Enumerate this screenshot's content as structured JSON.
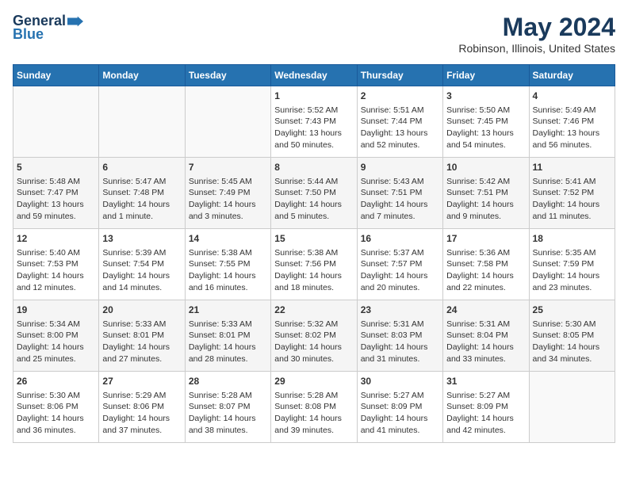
{
  "logo": {
    "line1": "General",
    "line2": "Blue"
  },
  "title": "May 2024",
  "subtitle": "Robinson, Illinois, United States",
  "days_of_week": [
    "Sunday",
    "Monday",
    "Tuesday",
    "Wednesday",
    "Thursday",
    "Friday",
    "Saturday"
  ],
  "weeks": [
    [
      {
        "day": "",
        "content": ""
      },
      {
        "day": "",
        "content": ""
      },
      {
        "day": "",
        "content": ""
      },
      {
        "day": "1",
        "content": "Sunrise: 5:52 AM\nSunset: 7:43 PM\nDaylight: 13 hours\nand 50 minutes."
      },
      {
        "day": "2",
        "content": "Sunrise: 5:51 AM\nSunset: 7:44 PM\nDaylight: 13 hours\nand 52 minutes."
      },
      {
        "day": "3",
        "content": "Sunrise: 5:50 AM\nSunset: 7:45 PM\nDaylight: 13 hours\nand 54 minutes."
      },
      {
        "day": "4",
        "content": "Sunrise: 5:49 AM\nSunset: 7:46 PM\nDaylight: 13 hours\nand 56 minutes."
      }
    ],
    [
      {
        "day": "5",
        "content": "Sunrise: 5:48 AM\nSunset: 7:47 PM\nDaylight: 13 hours\nand 59 minutes."
      },
      {
        "day": "6",
        "content": "Sunrise: 5:47 AM\nSunset: 7:48 PM\nDaylight: 14 hours\nand 1 minute."
      },
      {
        "day": "7",
        "content": "Sunrise: 5:45 AM\nSunset: 7:49 PM\nDaylight: 14 hours\nand 3 minutes."
      },
      {
        "day": "8",
        "content": "Sunrise: 5:44 AM\nSunset: 7:50 PM\nDaylight: 14 hours\nand 5 minutes."
      },
      {
        "day": "9",
        "content": "Sunrise: 5:43 AM\nSunset: 7:51 PM\nDaylight: 14 hours\nand 7 minutes."
      },
      {
        "day": "10",
        "content": "Sunrise: 5:42 AM\nSunset: 7:51 PM\nDaylight: 14 hours\nand 9 minutes."
      },
      {
        "day": "11",
        "content": "Sunrise: 5:41 AM\nSunset: 7:52 PM\nDaylight: 14 hours\nand 11 minutes."
      }
    ],
    [
      {
        "day": "12",
        "content": "Sunrise: 5:40 AM\nSunset: 7:53 PM\nDaylight: 14 hours\nand 12 minutes."
      },
      {
        "day": "13",
        "content": "Sunrise: 5:39 AM\nSunset: 7:54 PM\nDaylight: 14 hours\nand 14 minutes."
      },
      {
        "day": "14",
        "content": "Sunrise: 5:38 AM\nSunset: 7:55 PM\nDaylight: 14 hours\nand 16 minutes."
      },
      {
        "day": "15",
        "content": "Sunrise: 5:38 AM\nSunset: 7:56 PM\nDaylight: 14 hours\nand 18 minutes."
      },
      {
        "day": "16",
        "content": "Sunrise: 5:37 AM\nSunset: 7:57 PM\nDaylight: 14 hours\nand 20 minutes."
      },
      {
        "day": "17",
        "content": "Sunrise: 5:36 AM\nSunset: 7:58 PM\nDaylight: 14 hours\nand 22 minutes."
      },
      {
        "day": "18",
        "content": "Sunrise: 5:35 AM\nSunset: 7:59 PM\nDaylight: 14 hours\nand 23 minutes."
      }
    ],
    [
      {
        "day": "19",
        "content": "Sunrise: 5:34 AM\nSunset: 8:00 PM\nDaylight: 14 hours\nand 25 minutes."
      },
      {
        "day": "20",
        "content": "Sunrise: 5:33 AM\nSunset: 8:01 PM\nDaylight: 14 hours\nand 27 minutes."
      },
      {
        "day": "21",
        "content": "Sunrise: 5:33 AM\nSunset: 8:01 PM\nDaylight: 14 hours\nand 28 minutes."
      },
      {
        "day": "22",
        "content": "Sunrise: 5:32 AM\nSunset: 8:02 PM\nDaylight: 14 hours\nand 30 minutes."
      },
      {
        "day": "23",
        "content": "Sunrise: 5:31 AM\nSunset: 8:03 PM\nDaylight: 14 hours\nand 31 minutes."
      },
      {
        "day": "24",
        "content": "Sunrise: 5:31 AM\nSunset: 8:04 PM\nDaylight: 14 hours\nand 33 minutes."
      },
      {
        "day": "25",
        "content": "Sunrise: 5:30 AM\nSunset: 8:05 PM\nDaylight: 14 hours\nand 34 minutes."
      }
    ],
    [
      {
        "day": "26",
        "content": "Sunrise: 5:30 AM\nSunset: 8:06 PM\nDaylight: 14 hours\nand 36 minutes."
      },
      {
        "day": "27",
        "content": "Sunrise: 5:29 AM\nSunset: 8:06 PM\nDaylight: 14 hours\nand 37 minutes."
      },
      {
        "day": "28",
        "content": "Sunrise: 5:28 AM\nSunset: 8:07 PM\nDaylight: 14 hours\nand 38 minutes."
      },
      {
        "day": "29",
        "content": "Sunrise: 5:28 AM\nSunset: 8:08 PM\nDaylight: 14 hours\nand 39 minutes."
      },
      {
        "day": "30",
        "content": "Sunrise: 5:27 AM\nSunset: 8:09 PM\nDaylight: 14 hours\nand 41 minutes."
      },
      {
        "day": "31",
        "content": "Sunrise: 5:27 AM\nSunset: 8:09 PM\nDaylight: 14 hours\nand 42 minutes."
      },
      {
        "day": "",
        "content": ""
      }
    ]
  ]
}
